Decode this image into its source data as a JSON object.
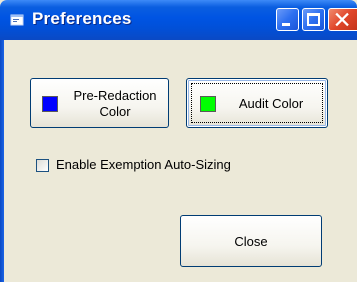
{
  "window": {
    "title": "Preferences",
    "controls": {
      "minimize_icon": "minimize-icon",
      "maximize_icon": "maximize-icon",
      "close_icon": "close-x-icon"
    }
  },
  "colors": {
    "pre_redaction": "#0000ff",
    "audit": "#00ff00",
    "title_bar": "#0054e3",
    "dialog_background": "#ece9d8"
  },
  "buttons": {
    "pre_redaction_line1": "Pre-Redaction",
    "pre_redaction_line2": "Color",
    "audit_color": "Audit Color",
    "close": "Close"
  },
  "options": {
    "exemption_auto_sizing": {
      "label": "Enable Exemption Auto-Sizing",
      "checked": false
    }
  }
}
